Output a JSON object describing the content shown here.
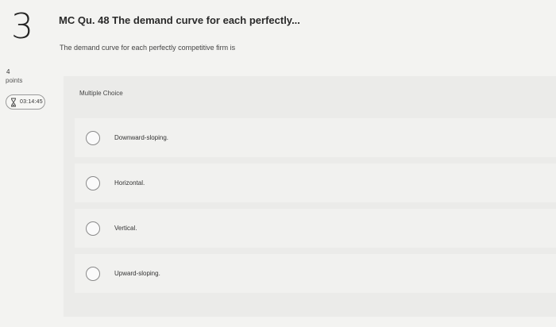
{
  "question": {
    "number": "3",
    "points_value": "4",
    "points_label": "points",
    "timer": "03:14:45",
    "title": "MC Qu. 48 The demand curve for each perfectly...",
    "prompt": "The demand curve for each perfectly competitive firm is"
  },
  "multiple_choice": {
    "label": "Multiple Choice",
    "options": [
      {
        "label": "Downward-sloping."
      },
      {
        "label": "Horizontal."
      },
      {
        "label": "Vertical."
      },
      {
        "label": "Upward-sloping."
      }
    ]
  },
  "icons": {
    "timer": "hourglass-icon"
  }
}
